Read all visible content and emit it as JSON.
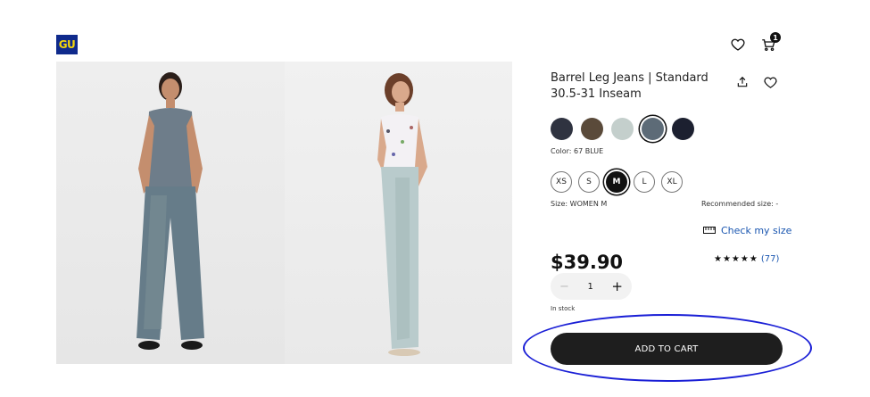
{
  "brand": {
    "logo_text": "GU",
    "logo_bg": "#0f2a8c",
    "logo_fg": "#f5d60a"
  },
  "header": {
    "wishlist_icon": "heart-icon",
    "cart_icon": "cart-icon",
    "cart_count": "1"
  },
  "gallery": {
    "images": [
      "model-front-image",
      "model-side-image"
    ]
  },
  "product": {
    "title": "Barrel Leg Jeans | Standard 30.5-31 Inseam",
    "share_icon": "share-icon",
    "favorite_icon": "heart-icon"
  },
  "colors": {
    "swatches": [
      {
        "hex": "#2f3340"
      },
      {
        "hex": "#5a4a3a"
      },
      {
        "hex": "#c4cfcc"
      },
      {
        "hex": "#5d6b77",
        "selected": true
      },
      {
        "hex": "#1c2030"
      }
    ],
    "label": "Color: 67 BLUE"
  },
  "sizes": {
    "options": [
      {
        "label": "XS"
      },
      {
        "label": "S"
      },
      {
        "label": "M",
        "selected": true
      },
      {
        "label": "L"
      },
      {
        "label": "XL"
      }
    ],
    "label": "Size: WOMEN M",
    "recommended": "Recommended size: -",
    "check_my_size": "Check my size"
  },
  "pricing": {
    "price": "$39.90",
    "stars": "★★★★★",
    "rating_value": 4.5,
    "reviews": "(77)"
  },
  "quantity": {
    "minus": "−",
    "value": "1",
    "plus": "+"
  },
  "stock": "In stock",
  "cta": {
    "add_to_cart": "ADD TO CART"
  },
  "annotation_color": "#1a1fd6"
}
